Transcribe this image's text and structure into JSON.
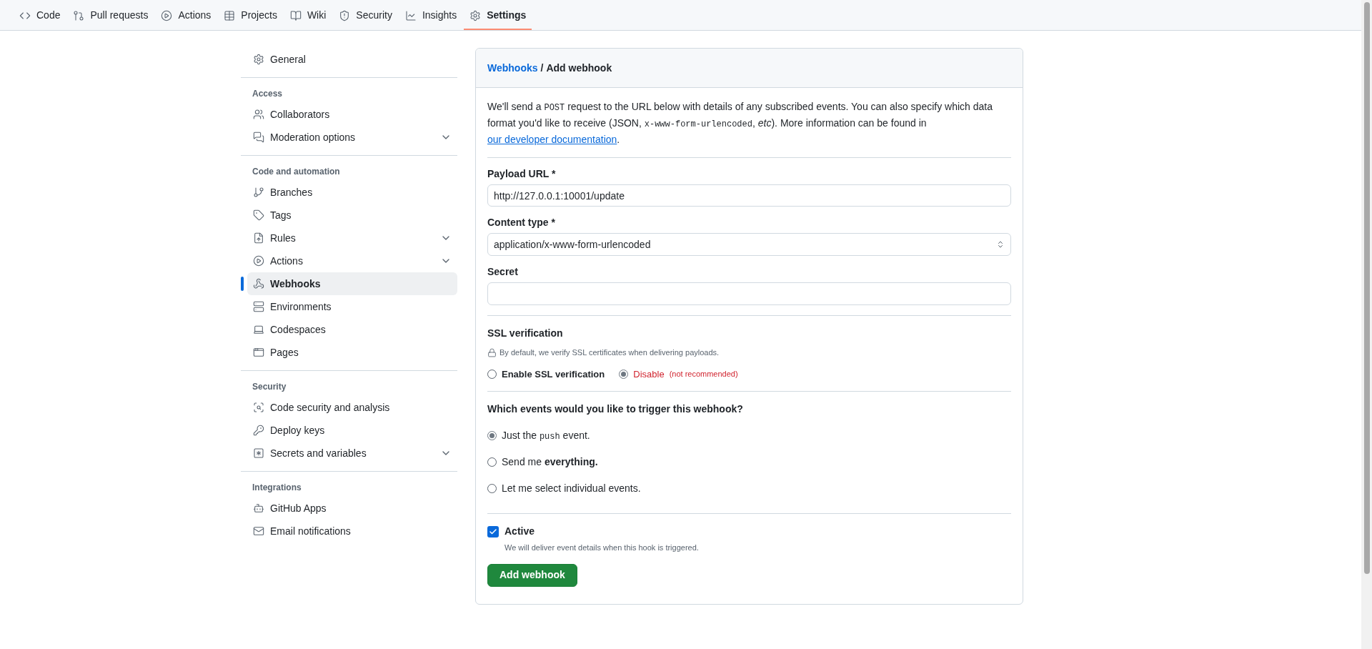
{
  "nav_tabs": [
    {
      "label": "Code",
      "selected": false
    },
    {
      "label": "Pull requests",
      "selected": false
    },
    {
      "label": "Actions",
      "selected": false
    },
    {
      "label": "Projects",
      "selected": false
    },
    {
      "label": "Wiki",
      "selected": false
    },
    {
      "label": "Security",
      "selected": false
    },
    {
      "label": "Insights",
      "selected": false
    },
    {
      "label": "Settings",
      "selected": true
    }
  ],
  "sidebar": {
    "top_items": [
      {
        "label": "General",
        "selected": false,
        "expandable": false
      }
    ],
    "sections": [
      {
        "heading": "Access",
        "items": [
          {
            "label": "Collaborators",
            "selected": false,
            "expandable": false
          },
          {
            "label": "Moderation options",
            "selected": false,
            "expandable": true
          }
        ]
      },
      {
        "heading": "Code and automation",
        "items": [
          {
            "label": "Branches",
            "selected": false,
            "expandable": false
          },
          {
            "label": "Tags",
            "selected": false,
            "expandable": false
          },
          {
            "label": "Rules",
            "selected": false,
            "expandable": true
          },
          {
            "label": "Actions",
            "selected": false,
            "expandable": true
          },
          {
            "label": "Webhooks",
            "selected": true,
            "expandable": false
          },
          {
            "label": "Environments",
            "selected": false,
            "expandable": false
          },
          {
            "label": "Codespaces",
            "selected": false,
            "expandable": false
          },
          {
            "label": "Pages",
            "selected": false,
            "expandable": false
          }
        ]
      },
      {
        "heading": "Security",
        "items": [
          {
            "label": "Code security and analysis",
            "selected": false,
            "expandable": false
          },
          {
            "label": "Deploy keys",
            "selected": false,
            "expandable": false
          },
          {
            "label": "Secrets and variables",
            "selected": false,
            "expandable": true
          }
        ]
      },
      {
        "heading": "Integrations",
        "items": [
          {
            "label": "GitHub Apps",
            "selected": false,
            "expandable": false
          },
          {
            "label": "Email notifications",
            "selected": false,
            "expandable": false
          }
        ]
      }
    ]
  },
  "form": {
    "breadcrumb": {
      "link": "Webhooks",
      "separator": "/",
      "current": "Add webhook"
    },
    "intro": [
      {
        "kind": "text",
        "text": "We'll send a "
      },
      {
        "kind": "code",
        "text": "POST"
      },
      {
        "kind": "text",
        "text": " request to the URL below with details of any subscribed events. You can also specify which data format you'd like to receive (JSON, "
      },
      {
        "kind": "code",
        "text": "x-www-form-urlencoded"
      },
      {
        "kind": "text",
        "text": ", "
      },
      {
        "kind": "italic",
        "text": "etc"
      },
      {
        "kind": "text",
        "text": "). More information can be found in "
      },
      {
        "kind": "link",
        "text": "our developer documentation"
      },
      {
        "kind": "text",
        "text": "."
      }
    ],
    "payload_url": {
      "label": "Payload URL *",
      "value": "http://127.0.0.1:10001/update"
    },
    "content_type": {
      "label": "Content type *",
      "value": "application/x-www-form-urlencoded"
    },
    "secret": {
      "label": "Secret"
    },
    "ssl": {
      "heading": "SSL verification",
      "note": "By default, we verify SSL certificates when delivering payloads.",
      "options": [
        {
          "kind": "normal",
          "label": "Enable SSL verification",
          "selected": false
        },
        {
          "kind": "danger",
          "label": "Disable",
          "hint": "(not recommended)",
          "selected": true
        }
      ]
    },
    "events": {
      "question": "Which events would you like to trigger this webhook?",
      "options": [
        {
          "selected": true,
          "parts": [
            {
              "kind": "text",
              "text": "Just the "
            },
            {
              "kind": "code",
              "text": "push"
            },
            {
              "kind": "text",
              "text": " event."
            }
          ]
        },
        {
          "selected": false,
          "parts": [
            {
              "kind": "text",
              "text": "Send me "
            },
            {
              "kind": "bold",
              "text": "everything."
            }
          ]
        },
        {
          "selected": false,
          "parts": [
            {
              "kind": "text",
              "text": "Let me select individual events."
            }
          ]
        }
      ]
    },
    "active": {
      "label": "Active",
      "checked": true,
      "note": "We will deliver event details when this hook is triggered."
    },
    "submit": "Add webhook"
  }
}
